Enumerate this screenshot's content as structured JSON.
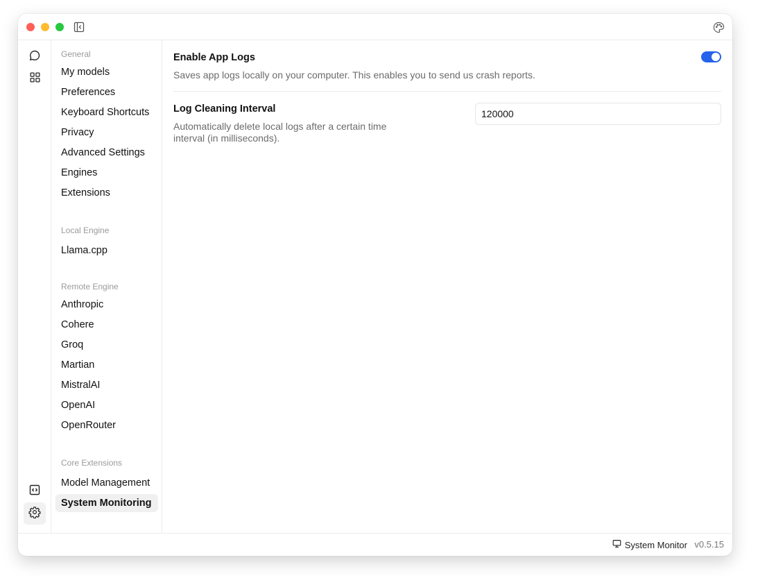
{
  "window": {
    "traffic_lights": [
      "close",
      "minimize",
      "maximize"
    ]
  },
  "titlebar": {
    "left_icon": "sidebar-collapse-icon",
    "right_icon": "palette-icon"
  },
  "rail": {
    "top_icons": [
      "chat-bubble-icon",
      "grid-icon"
    ],
    "bottom_icons": [
      "code-box-icon",
      "gear-icon"
    ],
    "active": "gear-icon"
  },
  "nav": {
    "sections": [
      {
        "title": "General",
        "items": [
          "My models",
          "Preferences",
          "Keyboard Shortcuts",
          "Privacy",
          "Advanced Settings",
          "Engines",
          "Extensions"
        ]
      },
      {
        "title": "Local Engine",
        "items": [
          "Llama.cpp"
        ]
      },
      {
        "title": "Remote Engine",
        "items": [
          "Anthropic",
          "Cohere",
          "Groq",
          "Martian",
          "MistralAI",
          "OpenAI",
          "OpenRouter"
        ]
      },
      {
        "title": "Core Extensions",
        "items": [
          "Model Management",
          "System Monitoring"
        ]
      }
    ],
    "active_item": "System Monitoring"
  },
  "main": {
    "app_logs": {
      "title": "Enable App Logs",
      "description": "Saves app logs locally on your computer. This enables you to send us crash reports.",
      "enabled": true,
      "accent": "#2563eb"
    },
    "log_cleaning": {
      "title": "Log Cleaning Interval",
      "description_line1": "Automatically delete local logs after a certain time",
      "description_line2": "interval (in milliseconds).",
      "value": "120000"
    }
  },
  "bottombar": {
    "system_monitor_label": "System Monitor",
    "system_monitor_icon": "monitor-icon",
    "version": "v0.5.15"
  }
}
